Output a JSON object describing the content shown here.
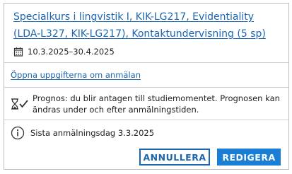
{
  "course": {
    "title": "Specialkurs i lingvistik I, KIK-LG217, Evidentiality (LDA-L327, KIK-LG217), Kontaktundervisning (5 sp)",
    "date_range": "10.3.2025–30.4.2025",
    "icon": "calendar-icon"
  },
  "task_link": {
    "label": "Öppna uppgifterna om anmälan"
  },
  "prognosis": {
    "icon": "hourglass-check-icon",
    "text": "Prognos: du blir antagen till studiemomentet. Prognosen kan ändras under och efter anmälningstiden."
  },
  "deadline": {
    "icon": "info-icon",
    "text": "Sista anmälningsdag 3.3.2025"
  },
  "actions": {
    "cancel_label": "ANNULLERA",
    "edit_label": "REDIGERA"
  },
  "colors": {
    "link": "#1a66b0",
    "primary": "#1a7fd4",
    "border": "#bdbdbd"
  }
}
